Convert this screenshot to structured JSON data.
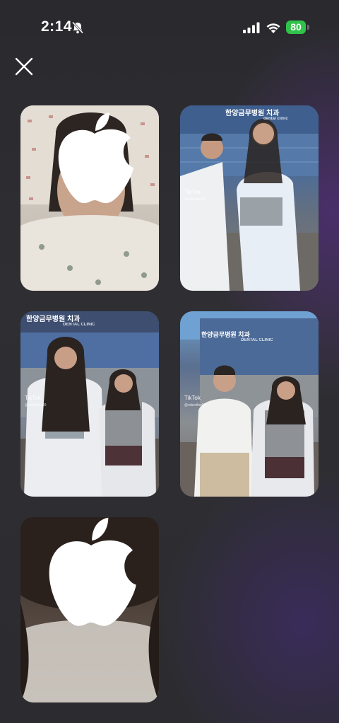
{
  "status_bar": {
    "time": "2:14",
    "battery": "80"
  },
  "icons": {
    "close": "close-icon",
    "bell_muted": "bell-slash-icon",
    "signal": "cellular-signal-icon",
    "wifi": "wifi-icon",
    "battery": "battery-charging-icon",
    "apple": "apple-logo-icon"
  },
  "tiles": [
    {
      "id": "photo-1"
    },
    {
      "id": "photo-2",
      "watermark": "TikTok",
      "user": "@robertfox00",
      "sign_text": "한양금무병원 치과",
      "sign_sub": "dental clinic"
    },
    {
      "id": "photo-3",
      "watermark": "TikTok",
      "user": "@robertfox00",
      "sign_text": "한양금무병원 치과",
      "sign_sub": "DENTAL CLINIC"
    },
    {
      "id": "photo-4",
      "watermark": "TikTok",
      "user": "@robertfox00",
      "sign_text": "한양금무병원 치과",
      "sign_sub": "DENTAL CLINIC"
    },
    {
      "id": "photo-5"
    }
  ],
  "colors": {
    "background": "#2c2c30",
    "battery_green": "#30c34a",
    "accent_purple": "#4a2f6a"
  }
}
